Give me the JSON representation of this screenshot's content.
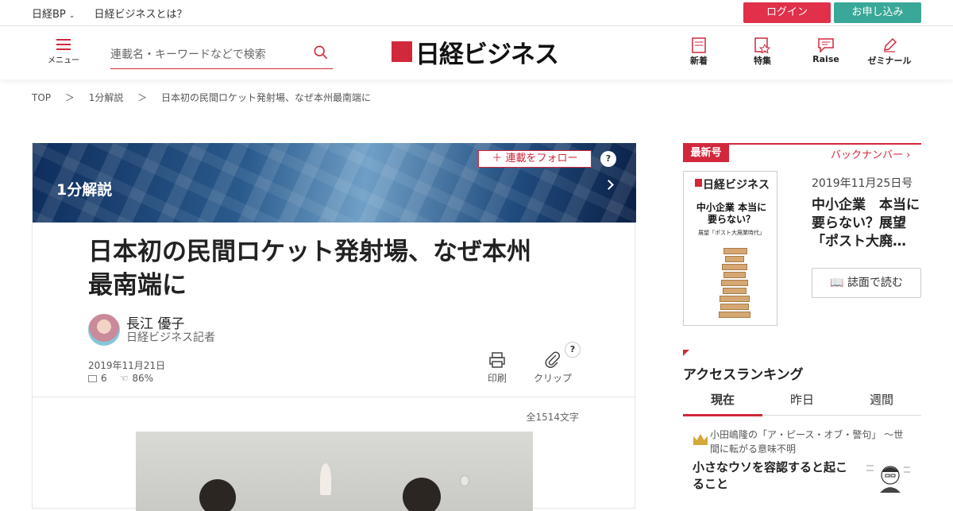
{
  "topbar": {
    "brand": "日経BP",
    "about": "日経ビジネスとは？",
    "login": "ログイン",
    "apply": "お申し込み"
  },
  "header": {
    "menu_label": "メニュー",
    "search_placeholder": "連載名・キーワードなどで検索",
    "logo_text": "日経ビジネス",
    "nav": [
      {
        "label": "新着",
        "icon": "new-icon"
      },
      {
        "label": "特集",
        "icon": "feature-icon"
      },
      {
        "label": "Raise",
        "icon": "raise-icon"
      },
      {
        "label": "ゼミナール",
        "icon": "seminar-icon"
      }
    ]
  },
  "breadcrumb": [
    "TOP",
    "＞",
    "1分解説",
    "＞",
    "日本初の民間ロケット発射場、なぜ本州最南端に"
  ],
  "article": {
    "series": "1分解説",
    "follow": "＋ 連載をフォロー",
    "help": "?",
    "title_line1": "日本初の民間ロケット発射場、なぜ本州",
    "title_line2": "最南端に",
    "author": "長江 優子",
    "author_role": "日経ビジネス記者",
    "date": "2019年11月21日",
    "comments": "6",
    "likes": "86%",
    "print": "印刷",
    "clip": "クリップ",
    "char_count": "全1514文字"
  },
  "sidebar": {
    "latest_tag": "最新号",
    "back_numbers": "バックナンバー",
    "cover_logo": "日経ビジネス",
    "cover_headline": "中小企業 本当に要らない？",
    "cover_sub": "展望「ポスト大廃業時代」",
    "issue_date": "2019年11月25日号",
    "issue_title": "中小企業　本当に要らない？展望「ポスト大廃…",
    "read_button": "誌面で読む",
    "ranking_title": "アクセスランキング",
    "ranking_tabs": [
      "現在",
      "昨日",
      "週間"
    ],
    "ranking_series": "小田嶋隆の「ア・ピース・オブ・警句」 ～世間に転がる意味不明",
    "ranking_headline": "小さなウソを容認すると起こること"
  },
  "colors": {
    "accent": "#d1283c",
    "login": "#e0304a",
    "apply": "#3aa898"
  }
}
